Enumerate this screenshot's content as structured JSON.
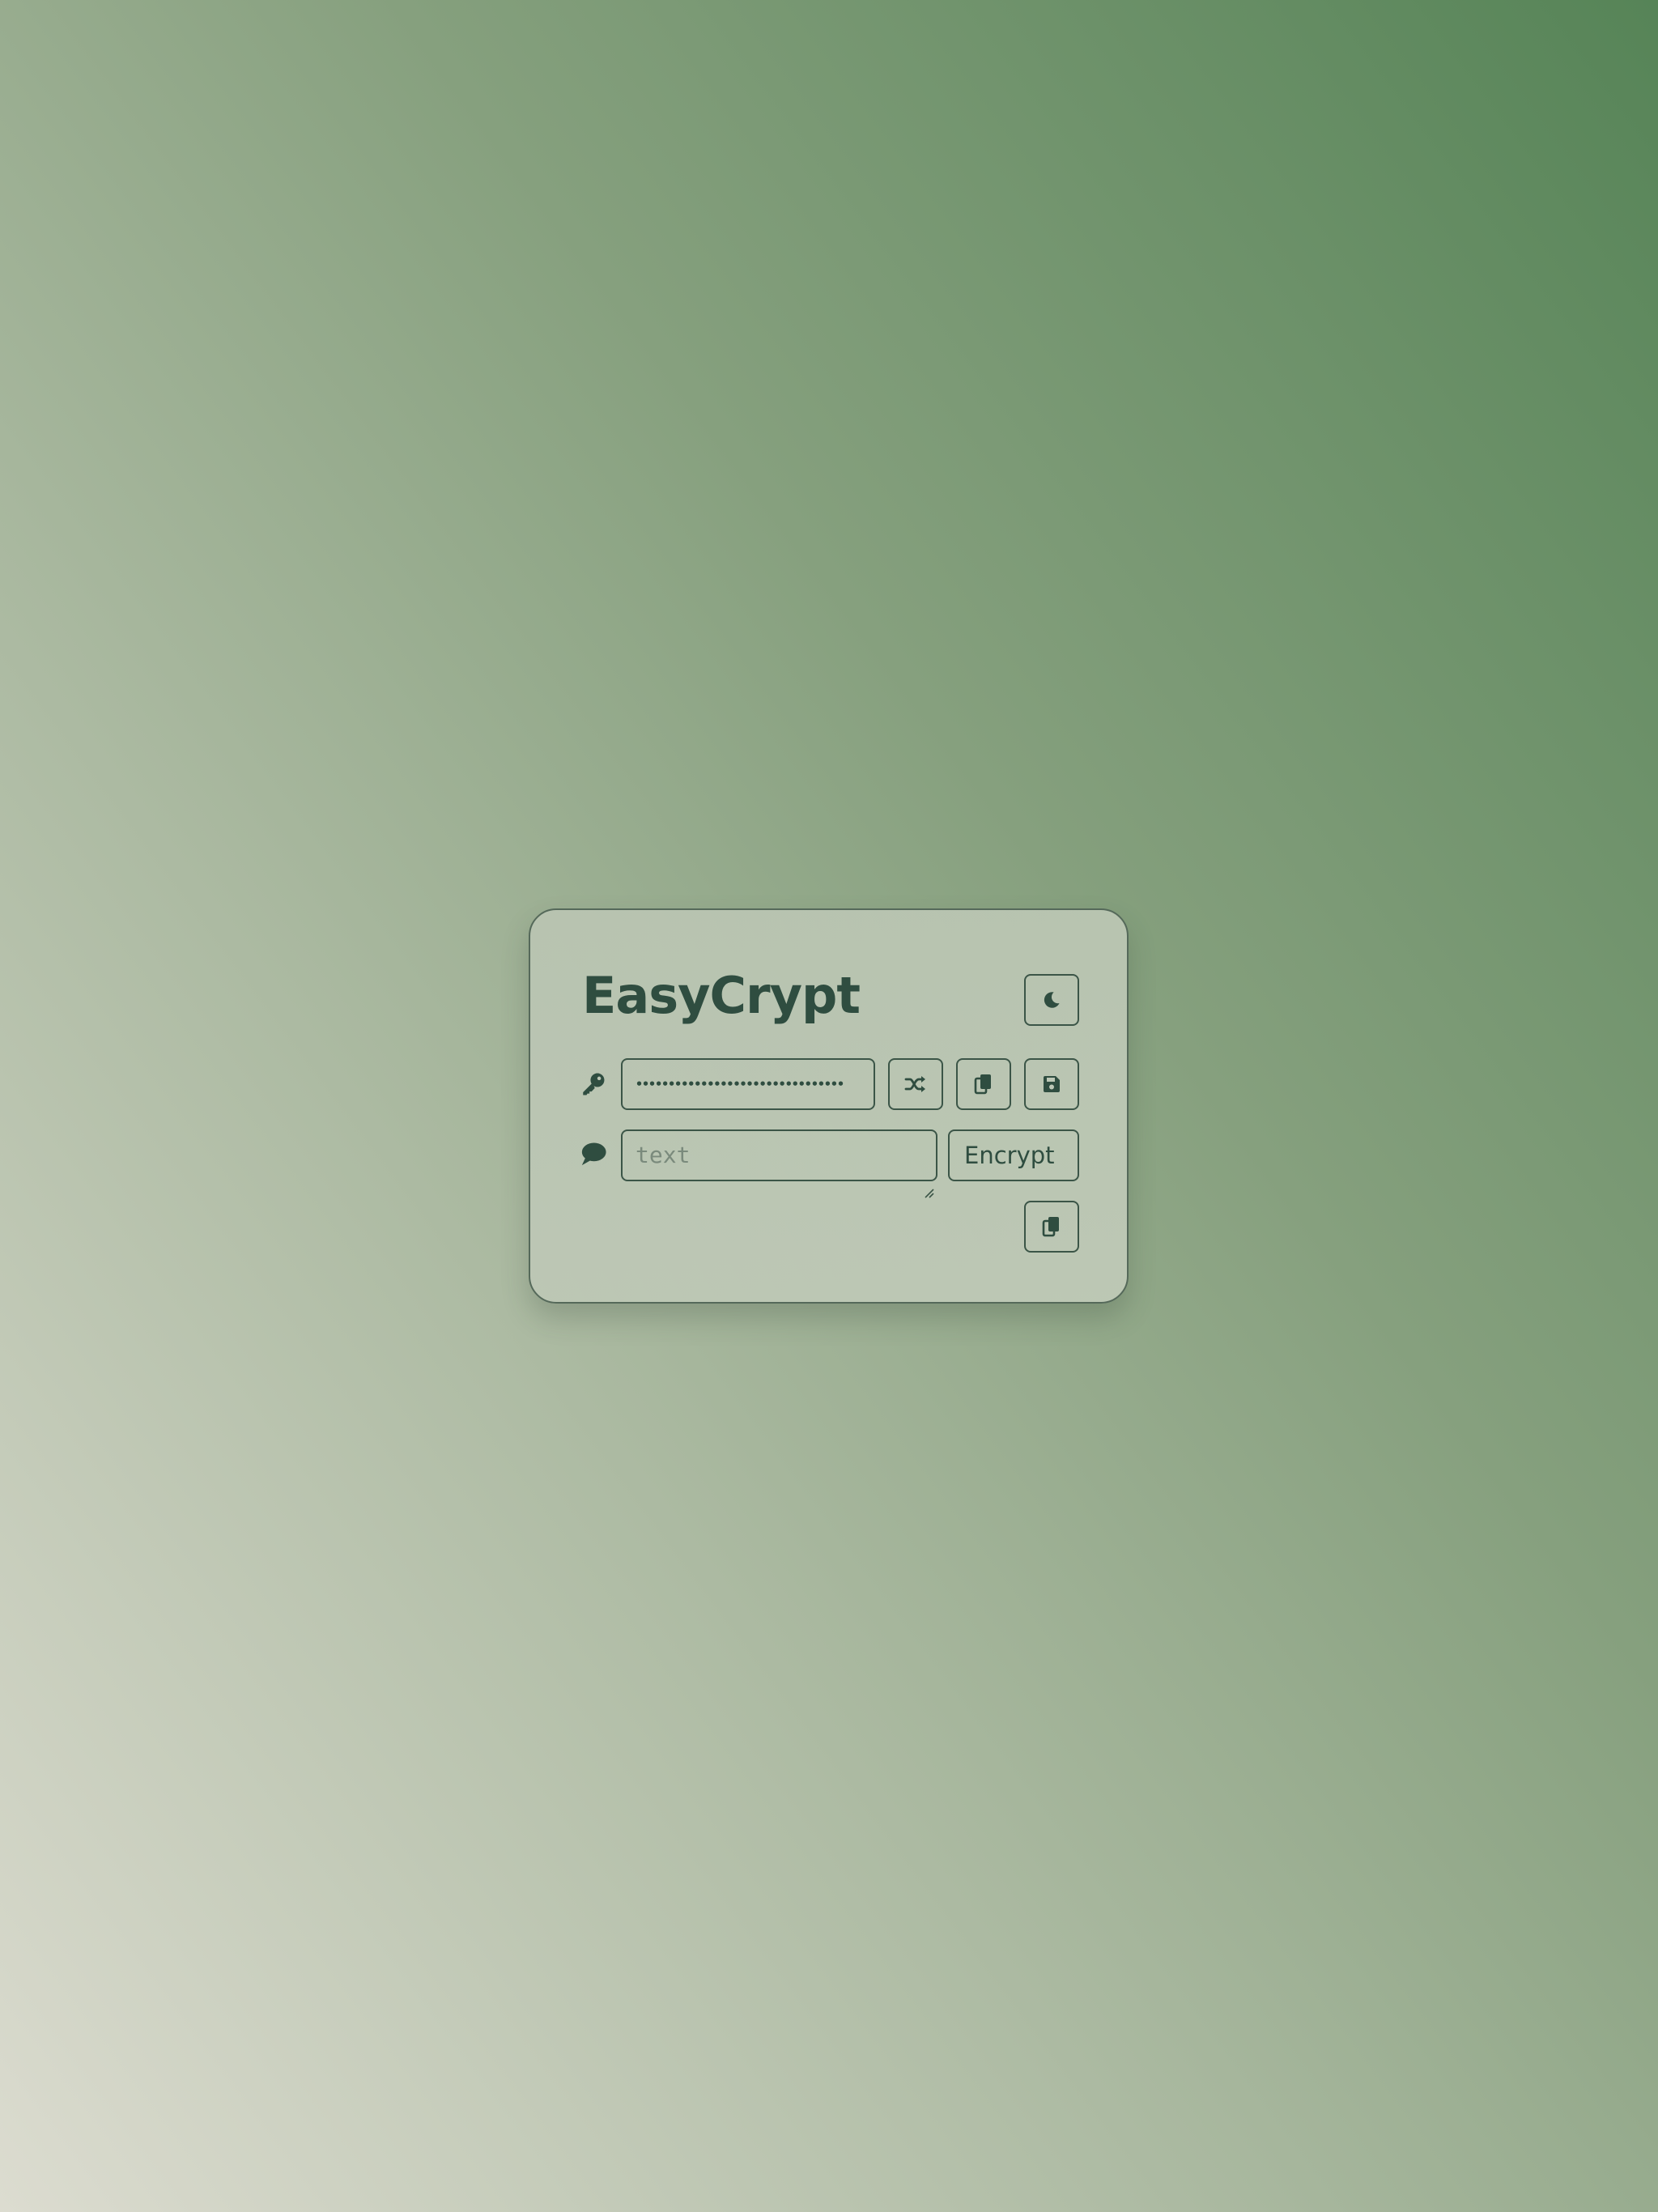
{
  "app": {
    "title": "EasyCrypt"
  },
  "header": {
    "theme_toggle_icon": "moon-icon"
  },
  "key_row": {
    "row_icon": "key-icon",
    "key_value_masked": "••••••••••••••••••••••••••••••••",
    "buttons": [
      {
        "name": "randomize-key-button",
        "icon": "shuffle-icon"
      },
      {
        "name": "copy-key-button",
        "icon": "copy-icon"
      },
      {
        "name": "save-key-button",
        "icon": "floppy-disk-icon"
      }
    ]
  },
  "text_row": {
    "row_icon": "speech-bubble-icon",
    "placeholder": "text",
    "value": "",
    "encrypt_label": "Encrypt"
  },
  "output_row": {
    "copy_icon": "copy-icon"
  },
  "colors": {
    "accent": "#2f4d40",
    "border": "#3b5547",
    "card_bg": "#bec8b7",
    "bg_top_right": "#568457",
    "bg_bottom_left": "#dcdcd0"
  }
}
